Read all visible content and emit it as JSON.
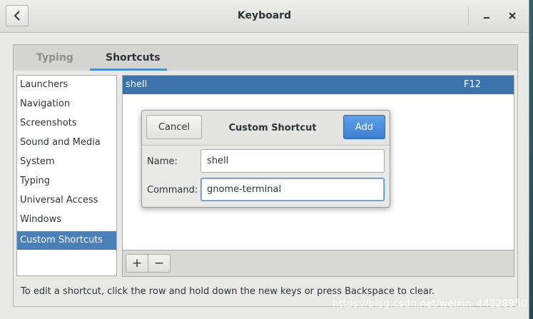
{
  "window": {
    "title": "Keyboard"
  },
  "tabs": [
    {
      "label": "Typing"
    },
    {
      "label": "Shortcuts"
    }
  ],
  "sidebar": {
    "items": [
      {
        "label": "Launchers"
      },
      {
        "label": "Navigation"
      },
      {
        "label": "Screenshots"
      },
      {
        "label": "Sound and Media"
      },
      {
        "label": "System"
      },
      {
        "label": "Typing"
      },
      {
        "label": "Universal Access"
      },
      {
        "label": "Windows"
      },
      {
        "label": "Custom Shortcuts"
      }
    ],
    "selected": "Custom Shortcuts"
  },
  "shortcuts": [
    {
      "name": "shell",
      "key": "F12"
    }
  ],
  "toolbar": {
    "add_label": "+",
    "remove_label": "−"
  },
  "hint": "To edit a shortcut, click the row and hold down the new keys or press Backspace to clear.",
  "dialog": {
    "title": "Custom Shortcut",
    "cancel_label": "Cancel",
    "add_label": "Add",
    "name_label": "Name:",
    "name_value": "shell",
    "command_label": "Command:",
    "command_value": "gnome-terminal"
  },
  "watermark": "https://blog.csdn.net/weixin_44828950",
  "colors": {
    "accent": "#4a90d9",
    "selection": "#3c73ad"
  },
  "icons": {
    "back": "go-previous-icon",
    "minimize": "minimize-icon",
    "close": "close-icon"
  }
}
